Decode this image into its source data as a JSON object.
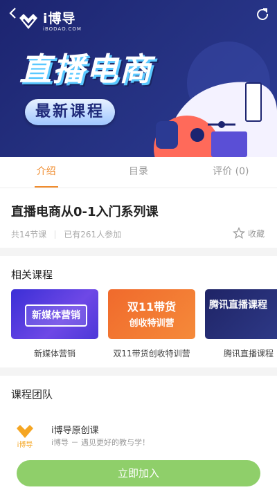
{
  "header": {
    "back_icon": "chevron-left-icon",
    "share_icon": "refresh-share-icon",
    "logo_name": "i博导",
    "logo_sub": "iBODAO.COM"
  },
  "banner": {
    "title": "直播电商",
    "badge": "最新课程",
    "colors": {
      "background": "#1c2470",
      "accent": "#ff6a5a",
      "badge": "#9fc6ff"
    }
  },
  "tabs": [
    {
      "label": "介绍",
      "active": true
    },
    {
      "label": "目录",
      "active": false
    },
    {
      "label": "评价 (0)",
      "active": false
    }
  ],
  "course": {
    "title": "直播电商从0-1入门系列课",
    "lessons": "共14节课",
    "participants": "已有261人参加",
    "favorite_label": "收藏",
    "favorite_icon": "star-outline-icon"
  },
  "related": {
    "title": "相关课程",
    "items": [
      {
        "label": "新媒体营销",
        "image_text": "新媒体营销"
      },
      {
        "label": "双11带货创收特训营",
        "image_line1": "双11带货",
        "image_line2": "创收特训营"
      },
      {
        "label": "腾讯直播课程",
        "image_text": "腾讯直播课程"
      }
    ]
  },
  "team": {
    "title": "课程团队",
    "name": "i博导原创课",
    "slogan": "i博导 － 遇见更好的教与学！"
  },
  "footer": {
    "join_label": "立即加入",
    "join_color": "#8fcf6a"
  }
}
